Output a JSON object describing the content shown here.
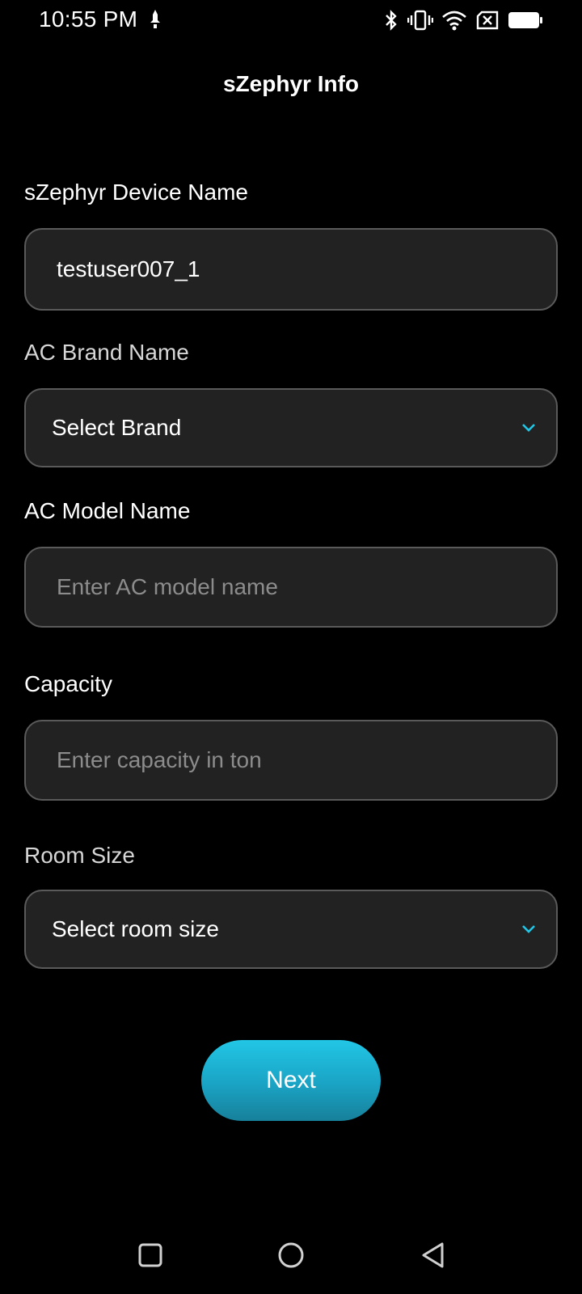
{
  "status_bar": {
    "time": "10:55 PM"
  },
  "header": {
    "title": "sZephyr Info"
  },
  "form": {
    "device_name": {
      "label": "sZephyr Device Name",
      "value": "testuser007_1"
    },
    "brand": {
      "label": "AC Brand Name",
      "selected": "Select Brand"
    },
    "model": {
      "label": "AC Model Name",
      "placeholder": "Enter AC model name"
    },
    "capacity": {
      "label": "Capacity",
      "placeholder": "Enter capacity in ton"
    },
    "room_size": {
      "label": "Room Size",
      "selected": "Select room size"
    }
  },
  "next_button": {
    "label": "Next"
  },
  "colors": {
    "background": "#000000",
    "field_bg": "#222222",
    "field_border": "#5a5a5a",
    "accent": "#22c6e6",
    "placeholder": "#8c8c8c"
  },
  "icons": {
    "status_left": "notification-icon",
    "bluetooth": "bluetooth-icon",
    "vibrate": "vibrate-icon",
    "wifi": "wifi-icon",
    "sim": "no-sim-icon",
    "battery": "battery-icon",
    "dropdown": "chevron-down-icon",
    "nav_recent": "square-icon",
    "nav_home": "circle-icon",
    "nav_back": "triangle-back-icon"
  }
}
